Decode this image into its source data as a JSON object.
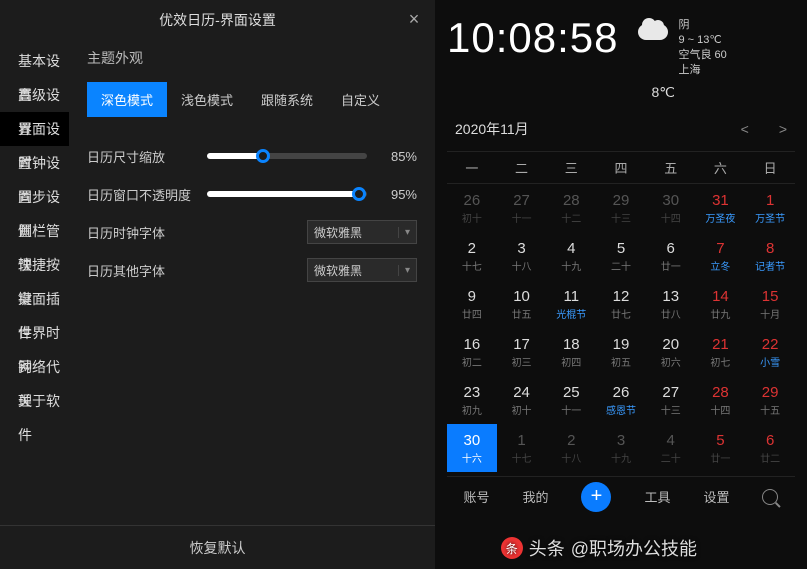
{
  "title": "优效日历-界面设置",
  "sidebar": {
    "items": [
      {
        "label": "基本设置"
      },
      {
        "label": "高级设置"
      },
      {
        "label": "界面设置"
      },
      {
        "label": "时钟设置"
      },
      {
        "label": "同步设置"
      },
      {
        "label": "侧栏管理"
      },
      {
        "label": "快捷按键"
      },
      {
        "label": "桌面插件"
      },
      {
        "label": "世界时钟"
      },
      {
        "label": "网络代理"
      },
      {
        "label": "关于软件"
      }
    ],
    "active": 2
  },
  "settings": {
    "section_title": "主题外观",
    "themes": [
      {
        "label": "深色模式",
        "active": true
      },
      {
        "label": "浅色模式"
      },
      {
        "label": "跟随系统"
      },
      {
        "label": "自定义"
      }
    ],
    "scale": {
      "label": "日历尺寸缩放",
      "value": "85%",
      "percent": 35
    },
    "opacity": {
      "label": "日历窗口不透明度",
      "value": "95%",
      "percent": 95
    },
    "clock_font": {
      "label": "日历时钟字体",
      "value": "微软雅黑"
    },
    "other_font": {
      "label": "日历其他字体",
      "value": "微软雅黑"
    },
    "restore": "恢复默认"
  },
  "clock": {
    "time": "10:08:58",
    "temp_now": "8℃"
  },
  "weather": {
    "cond": "阴",
    "range": "9 ~ 13℃",
    "air": "空气良 60",
    "city": "上海"
  },
  "calendar": {
    "month_label": "2020年11月",
    "nav_prev": "<",
    "nav_next": ">",
    "weekdays": [
      "一",
      "二",
      "三",
      "四",
      "五",
      "六",
      "日"
    ],
    "days": [
      {
        "n": "26",
        "s": "初十",
        "dim": true
      },
      {
        "n": "27",
        "s": "十一",
        "dim": true
      },
      {
        "n": "28",
        "s": "十二",
        "dim": true
      },
      {
        "n": "29",
        "s": "十三",
        "dim": true
      },
      {
        "n": "30",
        "s": "十四",
        "dim": true
      },
      {
        "n": "31",
        "s": "万圣夜",
        "dim": true,
        "sat": true,
        "sc": "blue"
      },
      {
        "n": "1",
        "s": "万圣节",
        "sun": true,
        "sc": "blue"
      },
      {
        "n": "2",
        "s": "十七"
      },
      {
        "n": "3",
        "s": "十八"
      },
      {
        "n": "4",
        "s": "十九"
      },
      {
        "n": "5",
        "s": "二十"
      },
      {
        "n": "6",
        "s": "廿一"
      },
      {
        "n": "7",
        "s": "立冬",
        "sat": true,
        "sc": "blue"
      },
      {
        "n": "8",
        "s": "记者节",
        "sun": true,
        "sc": "blue"
      },
      {
        "n": "9",
        "s": "廿四"
      },
      {
        "n": "10",
        "s": "廿五"
      },
      {
        "n": "11",
        "s": "光棍节",
        "sc": "blue"
      },
      {
        "n": "12",
        "s": "廿七"
      },
      {
        "n": "13",
        "s": "廿八"
      },
      {
        "n": "14",
        "s": "廿九",
        "sat": true
      },
      {
        "n": "15",
        "s": "十月",
        "sun": true
      },
      {
        "n": "16",
        "s": "初二"
      },
      {
        "n": "17",
        "s": "初三"
      },
      {
        "n": "18",
        "s": "初四"
      },
      {
        "n": "19",
        "s": "初五"
      },
      {
        "n": "20",
        "s": "初六"
      },
      {
        "n": "21",
        "s": "初七",
        "sat": true
      },
      {
        "n": "22",
        "s": "小雪",
        "sun": true,
        "sc": "blue"
      },
      {
        "n": "23",
        "s": "初九"
      },
      {
        "n": "24",
        "s": "初十"
      },
      {
        "n": "25",
        "s": "十一"
      },
      {
        "n": "26",
        "s": "感恩节",
        "sc": "blue"
      },
      {
        "n": "27",
        "s": "十三"
      },
      {
        "n": "28",
        "s": "十四",
        "sat": true
      },
      {
        "n": "29",
        "s": "十五",
        "sun": true
      },
      {
        "n": "30",
        "s": "十六",
        "selected": true
      },
      {
        "n": "1",
        "s": "十七",
        "dim": true
      },
      {
        "n": "2",
        "s": "十八",
        "dim": true
      },
      {
        "n": "3",
        "s": "十九",
        "dim": true
      },
      {
        "n": "4",
        "s": "二十",
        "dim": true
      },
      {
        "n": "5",
        "s": "廿一",
        "dim": true,
        "sat": true
      },
      {
        "n": "6",
        "s": "廿二",
        "dim": true,
        "sun": true
      }
    ]
  },
  "toolbar": {
    "account": "账号",
    "mine": "我的",
    "tools": "工具",
    "settings": "设置"
  },
  "watermark": {
    "prefix": "头条",
    "handle": "@职场办公技能"
  }
}
